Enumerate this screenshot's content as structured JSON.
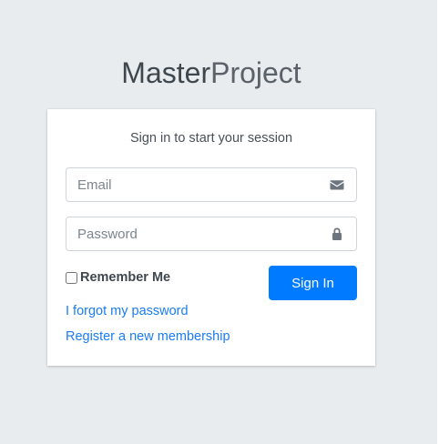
{
  "logo": {
    "bold": "Master",
    "light": "Project"
  },
  "card": {
    "message": "Sign in to start your session",
    "email": {
      "placeholder": "Email",
      "icon": "envelope-icon"
    },
    "password": {
      "placeholder": "Password",
      "icon": "lock-icon"
    },
    "remember_label": "Remember Me",
    "remember_checked": false,
    "signin_label": "Sign In",
    "forgot_link": "I forgot my password",
    "register_link": "Register a new membership"
  },
  "colors": {
    "page_background": "#e9ecef",
    "primary": "#007bff",
    "link": "#1a7cf2"
  }
}
